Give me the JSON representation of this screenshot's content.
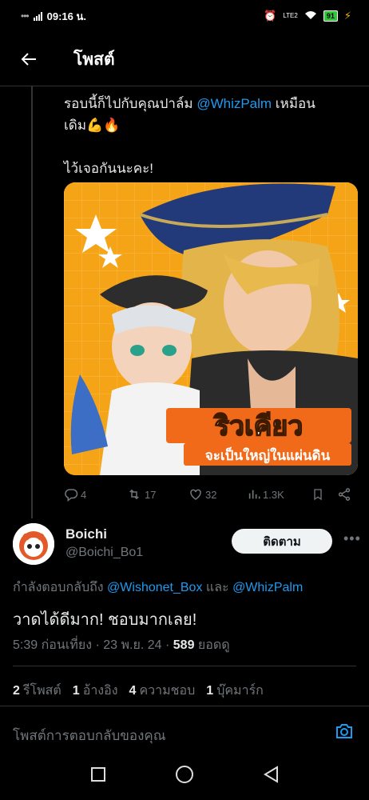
{
  "status_bar": {
    "time": "09:16 น.",
    "network": "LTE2",
    "battery": "91"
  },
  "header": {
    "title": "โพสต์"
  },
  "tweet": {
    "line1_prefix": "รอบนี้ก็ไปกับคุณปาล์ม ",
    "line1_mention": "@WhizPalm",
    "line1_suffix": " เหมือน",
    "line2": "เดิม💪🔥",
    "line3": "ไว้เจอกันนะคะ!",
    "image": {
      "title_big": "ริวเคียว",
      "title_small": "จะเป็นใหญ่ในแผ่นดิน",
      "bg_color": "#f6a417"
    },
    "actions": {
      "replies": "4",
      "retweets": "17",
      "likes": "32",
      "views": "1.3K"
    }
  },
  "reply": {
    "name": "Boichi",
    "handle": "@Boichi_Bo1",
    "follow_label": "ติดตาม",
    "replying_prefix": "กำลังตอบกลับถึง ",
    "replying_to_1": "@Wishonet_Box",
    "replying_and": " และ ",
    "replying_to_2": "@WhizPalm",
    "text": "วาดได้ดีมาก! ชอบมากเลย!",
    "meta_time": "5:39 ก่อนเที่ยง · 23 พ.ย. 24 · ",
    "meta_views": "589",
    "meta_views_label": " ยอดดู",
    "stats": [
      {
        "count": "2",
        "label": "รีโพสต์"
      },
      {
        "count": "1",
        "label": "อ้างอิง"
      },
      {
        "count": "4",
        "label": "ความชอบ"
      },
      {
        "count": "1",
        "label": "บุ๊คมาร์ก"
      }
    ]
  },
  "compose": {
    "placeholder": "โพสต์การตอบกลับของคุณ"
  },
  "colors": {
    "accent": "#1d9bf0",
    "background": "#000000",
    "muted": "#71767b"
  }
}
